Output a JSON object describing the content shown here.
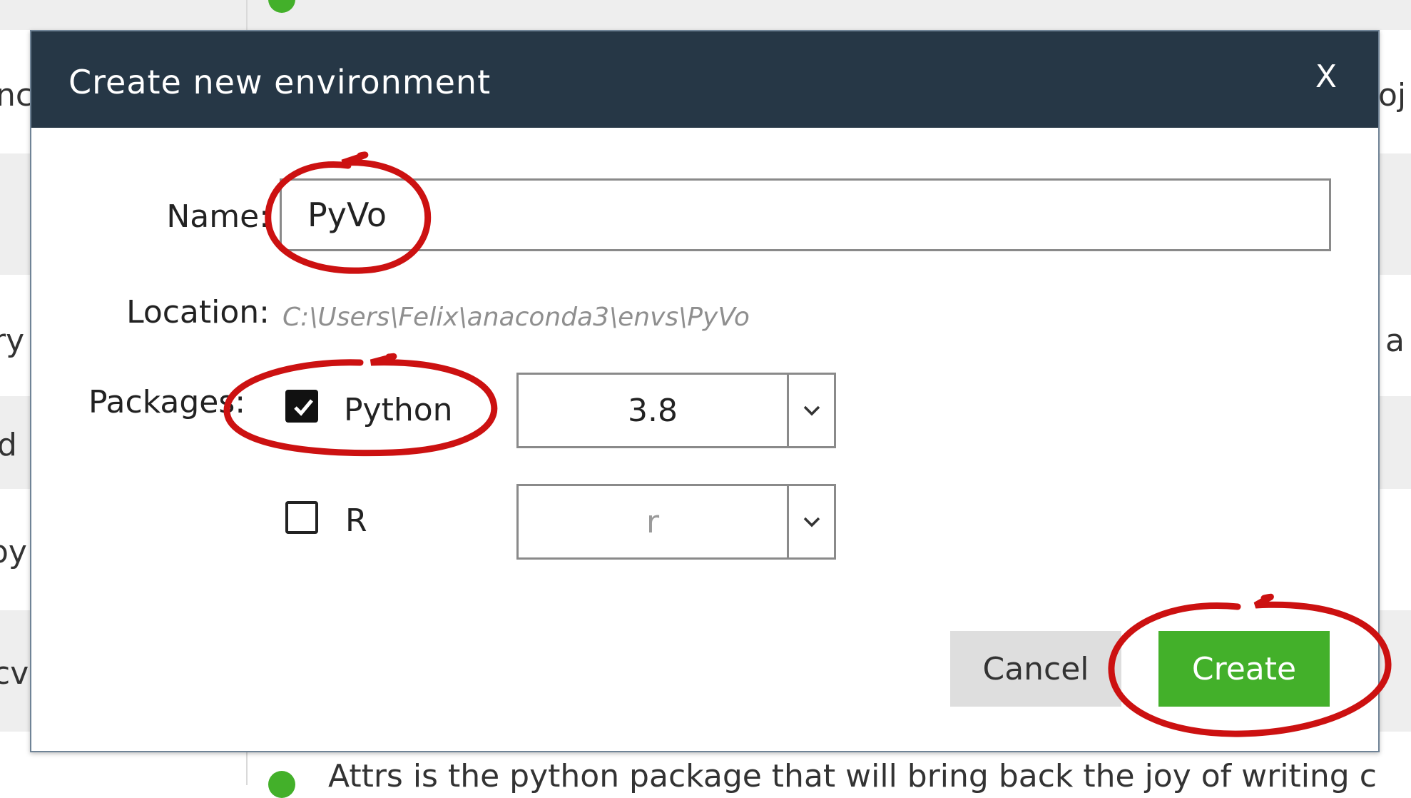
{
  "background": {
    "left_fragments": [
      "nc",
      "ry",
      "d",
      "py",
      "cv"
    ],
    "right_fragments": [
      "oj",
      "a"
    ],
    "bottom_text": "Attrs is the python package that will bring back the joy of writing c"
  },
  "dialog": {
    "title": "Create new environment",
    "close_label": "X",
    "name_label": "Name:",
    "name_value": "PyVo",
    "location_label": "Location:",
    "location_value": "C:\\Users\\Felix\\anaconda3\\envs\\PyVo",
    "packages_label": "Packages:",
    "packages": [
      {
        "label": "Python",
        "checked": true,
        "version": "3.8",
        "enabled": true
      },
      {
        "label": "R",
        "checked": false,
        "version": "r",
        "enabled": false
      }
    ],
    "cancel_label": "Cancel",
    "create_label": "Create"
  },
  "colors": {
    "titlebar": "#263746",
    "create_button": "#43b02a",
    "annotation": "#cc1111"
  }
}
